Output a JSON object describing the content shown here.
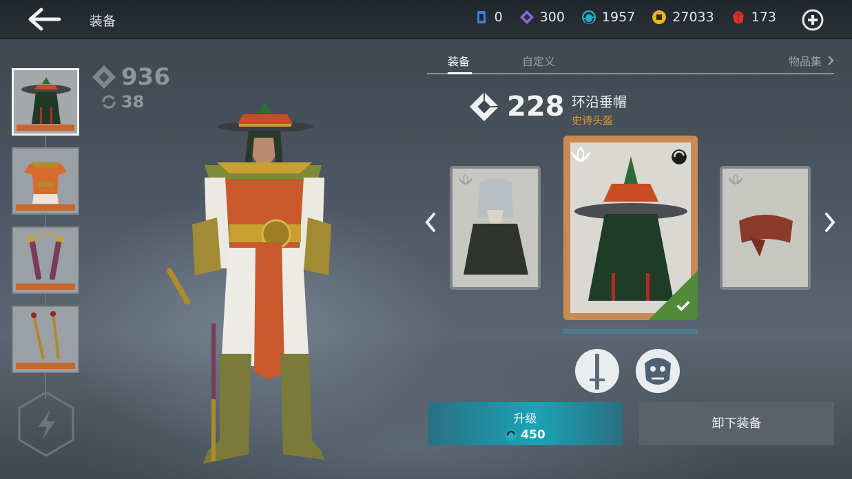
{
  "header": {
    "title": "装备",
    "currencies": [
      {
        "icon": "card-icon",
        "value": "0",
        "color": "#3f7fd6"
      },
      {
        "icon": "purple-diamond-icon",
        "value": "300",
        "color": "#8b6ad6"
      },
      {
        "icon": "swirl-icon",
        "value": "1957",
        "color": "#2aa9c4"
      },
      {
        "icon": "coin-icon",
        "value": "27033",
        "color": "#e7b424"
      },
      {
        "icon": "ruby-icon",
        "value": "173",
        "color": "#d9332e"
      }
    ]
  },
  "left_stats": {
    "power": "936",
    "level": "38"
  },
  "slots": [
    {
      "name": "helmet",
      "active": true
    },
    {
      "name": "armor",
      "active": false
    },
    {
      "name": "nunchaku",
      "active": false
    },
    {
      "name": "sai",
      "active": false
    }
  ],
  "tabs": {
    "equip": "装备",
    "custom": "自定义",
    "collection": "物品集"
  },
  "item": {
    "power": "228",
    "name": "环沿垂帽",
    "type": "史诗头盔",
    "type_color": "#e29b2c"
  },
  "actions": {
    "upgrade_label": "升级",
    "upgrade_cost": "450",
    "unequip_label": "卸下装备"
  }
}
